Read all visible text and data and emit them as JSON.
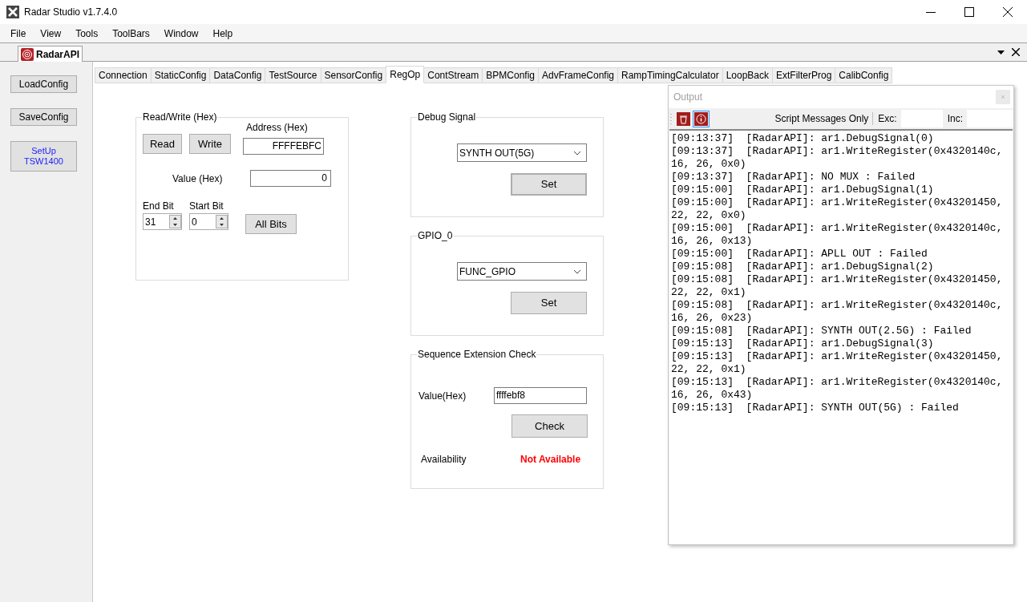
{
  "window": {
    "title": "Radar Studio v1.7.4.0"
  },
  "menu": [
    "File",
    "View",
    "Tools",
    "ToolBars",
    "Window",
    "Help"
  ],
  "document_tab": {
    "label": "RadarAPI"
  },
  "sidebar_buttons": [
    {
      "label": "LoadConfig",
      "kind": "plain"
    },
    {
      "label": "SaveConfig",
      "kind": "plain"
    },
    {
      "label": "SetUp TSW1400",
      "kind": "link"
    }
  ],
  "tabs": [
    {
      "label": "Connection",
      "selected": false
    },
    {
      "label": "StaticConfig",
      "selected": false
    },
    {
      "label": "DataConfig",
      "selected": false
    },
    {
      "label": "TestSource",
      "selected": false
    },
    {
      "label": "SensorConfig",
      "selected": false
    },
    {
      "label": "RegOp",
      "selected": true
    },
    {
      "label": "ContStream",
      "selected": false
    },
    {
      "label": "BPMConfig",
      "selected": false
    },
    {
      "label": "AdvFrameConfig",
      "selected": false
    },
    {
      "label": "RampTimingCalculator",
      "selected": false
    },
    {
      "label": "LoopBack",
      "selected": false
    },
    {
      "label": "ExtFilterProg",
      "selected": false
    },
    {
      "label": "CalibConfig",
      "selected": false
    }
  ],
  "read_write": {
    "title": "Read/Write (Hex)",
    "read_button": "Read",
    "write_button": "Write",
    "address_label": "Address (Hex)",
    "address": "FFFFEBFC",
    "value_label": "Value (Hex)",
    "value": "0",
    "end_bit_label": "End Bit",
    "end_bit": "31",
    "start_bit_label": "Start Bit",
    "start_bit": "0",
    "all_bits_button": "All Bits"
  },
  "debug_signal": {
    "title": "Debug Signal",
    "selection": "SYNTH OUT(5G)",
    "set_button": "Set",
    "set_focused": true
  },
  "gpio": {
    "title": "GPIO_0",
    "selection": "FUNC_GPIO",
    "set_button": "Set",
    "set_focused": false
  },
  "sequence_check": {
    "title": "Sequence Extension Check",
    "value_label": "Value(Hex)",
    "value": "ffffebf8",
    "check_button": "Check",
    "availability_label": "Availability",
    "availability": "Not Available"
  },
  "output": {
    "title": "Output",
    "filter": "Script Messages Only",
    "exc_label": "Exc:",
    "inc_label": "Inc:",
    "log_lines": [
      "[09:13:37]  [RadarAPI]: ar1.DebugSignal(0)",
      "[09:13:37]  [RadarAPI]: ar1.WriteRegister(0x4320140c,",
      "16, 26, 0x0)",
      "[09:13:37]  [RadarAPI]: NO MUX : Failed",
      "[09:15:00]  [RadarAPI]: ar1.DebugSignal(1)",
      "[09:15:00]  [RadarAPI]: ar1.WriteRegister(0x43201450,",
      "22, 22, 0x0)",
      "[09:15:00]  [RadarAPI]: ar1.WriteRegister(0x4320140c,",
      "16, 26, 0x13)",
      "[09:15:00]  [RadarAPI]: APLL OUT : Failed",
      "[09:15:08]  [RadarAPI]: ar1.DebugSignal(2)",
      "[09:15:08]  [RadarAPI]: ar1.WriteRegister(0x43201450,",
      "22, 22, 0x1)",
      "[09:15:08]  [RadarAPI]: ar1.WriteRegister(0x4320140c,",
      "16, 26, 0x23)",
      "[09:15:08]  [RadarAPI]: SYNTH OUT(2.5G) : Failed",
      "[09:15:13]  [RadarAPI]: ar1.DebugSignal(3)",
      "[09:15:13]  [RadarAPI]: ar1.WriteRegister(0x43201450,",
      "22, 22, 0x1)",
      "[09:15:13]  [RadarAPI]: ar1.WriteRegister(0x4320140c,",
      "16, 26, 0x43)",
      "[09:15:13]  [RadarAPI]: SYNTH OUT(5G) : Failed"
    ]
  }
}
